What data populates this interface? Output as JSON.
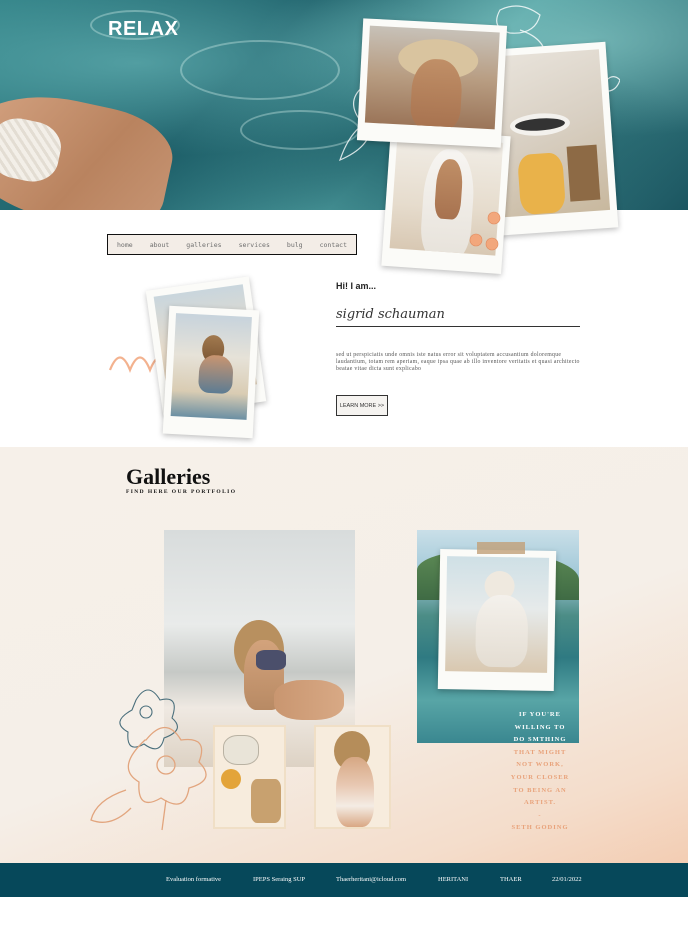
{
  "site": {
    "logo": "RELAX"
  },
  "nav": {
    "items": [
      "home",
      "about",
      "galleries",
      "services",
      "bulg",
      "contact"
    ]
  },
  "about": {
    "greeting": "Hi! I am...",
    "signature": "sigrid schauman",
    "bio": "sed ut perspiciatis unde omnis iste natus error sit voluptatem accusantium doloremque laudantium, totam rem aperiam, eaque ipsa quae ab illo inventore veritatis et quasi architecto beatae vitae dicta sunt explicabo",
    "button": "LEARN MORE >>"
  },
  "galleries": {
    "title": "Galleries",
    "subtitle": "FIND HERE OUR PORTFOLIO",
    "quote": [
      "IF YOU'RE",
      "WILLING TO",
      "DO SMTHING",
      "THAT MIGHT",
      "NOT WORK,",
      "YOUR CLOSER",
      "TO BEING AN",
      "ARTIST.",
      "-",
      "SETH GODING"
    ]
  },
  "footer": {
    "items": [
      "Evaluation formative",
      "IPEPS Seraing SUP",
      "Thaerheritani@icloud.com",
      "HERITANI",
      "THAER",
      "22/01/2022"
    ]
  },
  "colors": {
    "accent": "#e8a27a",
    "footer_bg": "#06485a",
    "water": "#2f7f84"
  }
}
